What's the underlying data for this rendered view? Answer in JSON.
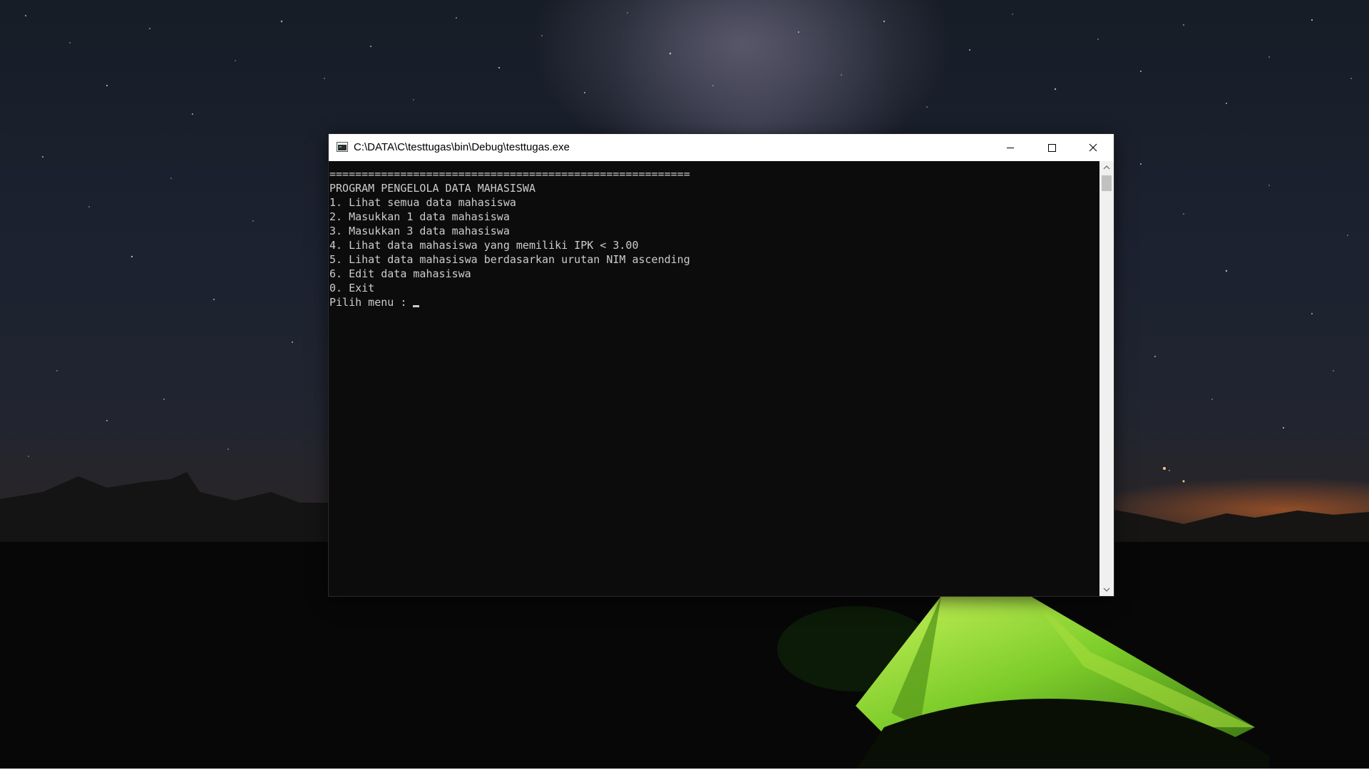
{
  "window": {
    "title": "C:\\DATA\\C\\testtugas\\bin\\Debug\\testtugas.exe",
    "buttons": {
      "minimize": "minimize-icon",
      "maximize": "maximize-icon",
      "close": "close-icon"
    }
  },
  "console": {
    "lines": [
      "========================================================",
      "PROGRAM PENGELOLA DATA MAHASISWA",
      "1. Lihat semua data mahasiswa",
      "2. Masukkan 1 data mahasiswa",
      "3. Masukkan 3 data mahasiswa",
      "4. Lihat data mahasiswa yang memiliki IPK < 3.00",
      "5. Lihat data mahasiswa berdasarkan urutan NIM ascending",
      "6. Edit data mahasiswa",
      "0. Exit"
    ],
    "prompt": "Pilih menu : ",
    "text_color": "#cccccc",
    "background_color": "#0c0c0c"
  },
  "scrollbar": {
    "up_icon": "chevron-up-icon",
    "down_icon": "chevron-down-icon"
  }
}
